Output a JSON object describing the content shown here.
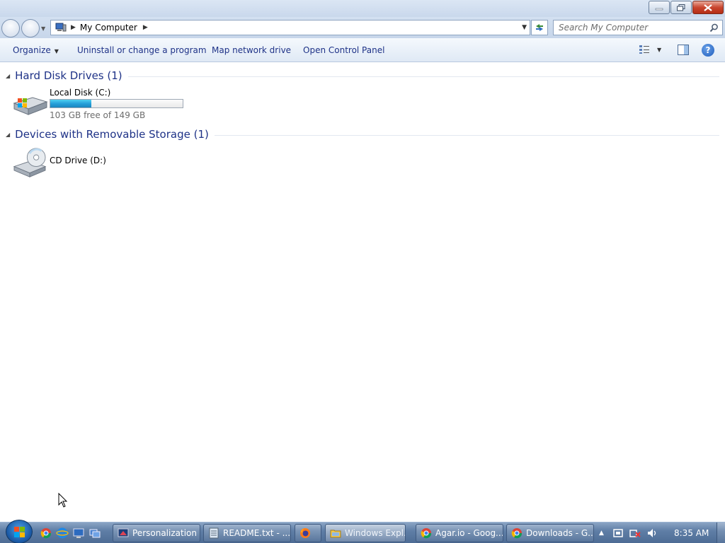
{
  "window": {
    "caption_buttons": {
      "minimize": "minimize",
      "maximize": "restore",
      "close": "close"
    }
  },
  "address": {
    "path": "My Computer",
    "search_placeholder": "Search My Computer"
  },
  "toolbar": {
    "organize": "Organize",
    "uninstall": "Uninstall or change a program",
    "map_drive": "Map network drive",
    "control_panel": "Open Control Panel"
  },
  "groups": [
    {
      "title": "Hard Disk Drives (1)",
      "items": [
        {
          "name": "Local Disk (C:)",
          "free_text": "103 GB free of 149 GB",
          "used_fraction": 0.31,
          "icon": "hard-disk-icon"
        }
      ]
    },
    {
      "title": "Devices with Removable Storage (1)",
      "items": [
        {
          "name": "CD Drive (D:)",
          "icon": "cd-drive-icon"
        }
      ]
    }
  ],
  "taskbar": {
    "quick_launch": [
      "chrome-icon",
      "ie-icon",
      "desktop-icon",
      "switch-windows-icon"
    ],
    "buttons": [
      {
        "label": "Personalization",
        "icon": "personalization-icon",
        "active": false
      },
      {
        "label": "README.txt - ...",
        "icon": "notepad-icon",
        "active": false
      },
      {
        "label": "",
        "icon": "firefox-icon",
        "active": false
      },
      {
        "label": "Windows Expl...",
        "icon": "explorer-icon",
        "active": true
      },
      {
        "label": "Agar.io - Goog...",
        "icon": "chrome-icon",
        "active": false
      },
      {
        "label": "Downloads - G...",
        "icon": "chrome-icon",
        "active": false
      }
    ],
    "clock": "8:35 AM"
  },
  "colors": {
    "accent_link": "#1e3287",
    "usage_fill": "#26a0da",
    "taskbar": "#4e6c95"
  }
}
